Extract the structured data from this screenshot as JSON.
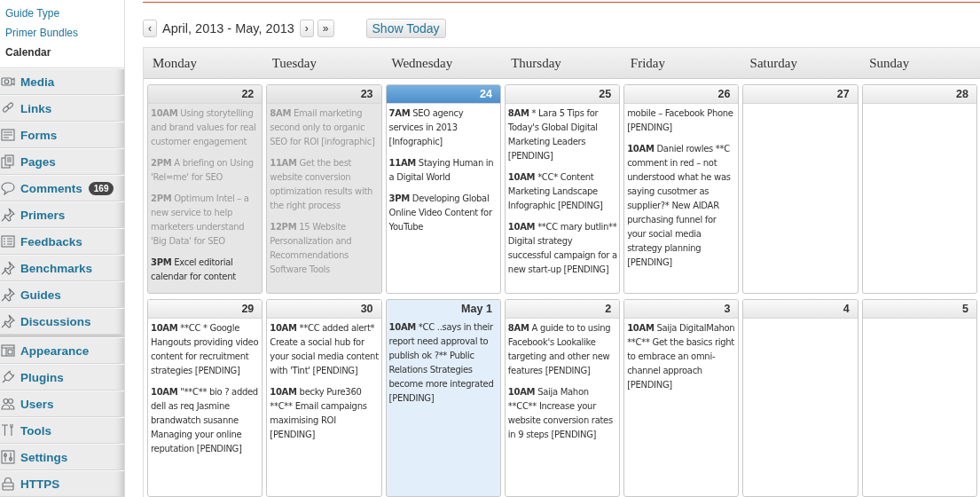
{
  "sidebar": {
    "submenu": [
      {
        "label": "Guide Type",
        "selected": false
      },
      {
        "label": "Primer Bundles",
        "selected": false
      },
      {
        "label": "Calendar",
        "selected": true
      }
    ],
    "menu_groups": [
      [
        {
          "label": "Media"
        },
        {
          "label": "Links"
        },
        {
          "label": "Forms"
        },
        {
          "label": "Pages"
        },
        {
          "label": "Comments",
          "badge": "169"
        },
        {
          "label": "Primers"
        },
        {
          "label": "Feedbacks"
        },
        {
          "label": "Benchmarks"
        },
        {
          "label": "Guides"
        },
        {
          "label": "Discussions"
        }
      ],
      [
        {
          "label": "Appearance"
        },
        {
          "label": "Plugins"
        },
        {
          "label": "Users"
        },
        {
          "label": "Tools"
        },
        {
          "label": "Settings"
        },
        {
          "label": "HTTPS"
        }
      ]
    ]
  },
  "toolbar": {
    "prev": "‹",
    "range": "April, 2013 - May, 2013",
    "next": "›",
    "next_far": "»",
    "today_button": "Show Today"
  },
  "calendar": {
    "weekdays": [
      "Monday",
      "Tuesday",
      "Wednesday",
      "Thursday",
      "Friday",
      "Saturday",
      "Sunday"
    ],
    "weeks": [
      [
        {
          "day": "22",
          "kind": "past",
          "events": [
            {
              "time": "10AM",
              "text": "Using storytelling and brand values for real customer engagement",
              "greyed": true
            },
            {
              "time": "2PM",
              "text": "A briefing on Using 'Rel=me' for SEO",
              "greyed": true
            },
            {
              "time": "2PM",
              "text": "Optimum Intel – a new service to help marketers understand 'Big Data' for SEO",
              "greyed": true
            },
            {
              "time": "3PM",
              "text": "Excel editorial calendar for content",
              "greyed": false
            }
          ]
        },
        {
          "day": "23",
          "kind": "past",
          "events": [
            {
              "time": "8AM",
              "text": "Email marketing second only to organic SEO for ROI [infographic]",
              "greyed": true
            },
            {
              "time": "11AM",
              "text": "Get the best website conversion optimization results with the right process",
              "greyed": true
            },
            {
              "time": "12PM",
              "text": "15 Website Personalization and Recommendations Software Tools",
              "greyed": true
            }
          ]
        },
        {
          "day": "24",
          "kind": "today",
          "events": [
            {
              "time": "7AM",
              "text": "SEO agency services in 2013 [Infographic]",
              "greyed": false
            },
            {
              "time": "11AM",
              "text": "Staying Human in a Digital World",
              "greyed": false
            },
            {
              "time": "3PM",
              "text": "Developing Global Online Video Content for YouTube",
              "greyed": false
            }
          ]
        },
        {
          "day": "25",
          "kind": "normal",
          "events": [
            {
              "time": "8AM",
              "text": "* Lara 5 Tips for Today's Global Digital Marketing Leaders [PENDING]",
              "greyed": false
            },
            {
              "time": "10AM",
              "text": "*CC* Content Marketing Landscape Infographic [PENDING]",
              "greyed": false
            },
            {
              "time": "10AM",
              "text": "**CC mary butlin** Digital strategy successful campaign for a new start-up [PENDING]",
              "greyed": false
            }
          ]
        },
        {
          "day": "26",
          "kind": "normal",
          "events": [
            {
              "text": "mobile – Facebook Phone [PENDING]",
              "greyed": false
            },
            {
              "time": "10AM",
              "text": "Daniel rowles **C comment in red – not understood what he was saying cusotmer as supplier?* New AIDAR purchasing funnel for your social media strategy planning [PENDING]",
              "greyed": false
            }
          ]
        },
        {
          "day": "27",
          "kind": "normal"
        },
        {
          "day": "28",
          "kind": "normal"
        }
      ],
      [
        {
          "day": "29",
          "kind": "normal",
          "events": [
            {
              "time": "10AM",
              "text": "**CC * Google Hangouts providing video content for recruitment strategies [PENDING]",
              "greyed": false
            },
            {
              "time": "10AM",
              "text": "\"**C** bio ? added dell as req Jasmine brandwatch susanne Managing your online reputation [PENDING]",
              "greyed": false
            }
          ]
        },
        {
          "day": "30",
          "kind": "normal",
          "events": [
            {
              "time": "10AM",
              "text": "**CC added alert* Create a social hub for your social media content with 'Tint' [PENDING]",
              "greyed": false
            },
            {
              "time": "10AM",
              "text": "becky Pure360 **C** Email campaigns maximising ROI [PENDING]",
              "greyed": false
            }
          ]
        },
        {
          "day": "May 1",
          "kind": "highlight",
          "events": [
            {
              "time": "10AM",
              "text": "*CC ..says in their report need approval to publish ok ?** Public Relations Strategies become more integrated [PENDING]",
              "greyed": false
            }
          ]
        },
        {
          "day": "2",
          "kind": "normal",
          "events": [
            {
              "time": "8AM",
              "text": "A guide to to using Facebook's Lookalike targeting and other new features [PENDING]",
              "greyed": false
            },
            {
              "time": "10AM",
              "text": "Saija Mahon **CC** Increase your website conversion rates in 9 steps [PENDING]",
              "greyed": false
            }
          ]
        },
        {
          "day": "3",
          "kind": "normal",
          "events": [
            {
              "time": "10AM",
              "text": "Saija DigitalMahon **C** Get the basics right to embrace an omni-channel approach [PENDING]",
              "greyed": false
            }
          ]
        },
        {
          "day": "4",
          "kind": "normal"
        },
        {
          "day": "5",
          "kind": "normal"
        }
      ]
    ]
  }
}
